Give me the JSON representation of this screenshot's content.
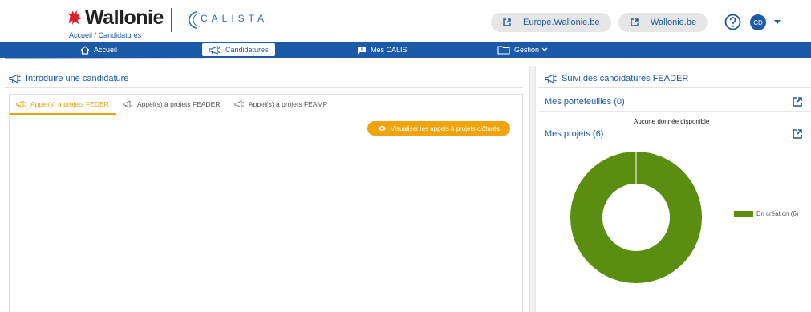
{
  "header": {
    "brand": "Wallonie",
    "app_name": "CALISTA",
    "breadcrumb": [
      "Accueil",
      "Candidatures"
    ],
    "breadcrumb_sep": "/",
    "links": [
      "Europe.Wallonie.be",
      "Wallonie.be"
    ],
    "user_initials": "CD",
    "icons": [
      "rooster-icon",
      "external-link-icon",
      "help-icon",
      "chevron-down-icon"
    ]
  },
  "nav": {
    "items": [
      {
        "label": "Accueil",
        "icon": "home-icon"
      },
      {
        "label": "Candidatures",
        "icon": "megaphone-icon",
        "active": true
      },
      {
        "label": "Mes CALIS",
        "icon": "chat-icon"
      },
      {
        "label": "Gestion",
        "icon": "folder-icon",
        "dropdown": true
      }
    ]
  },
  "left": {
    "title": "Introduire une candidature",
    "tabs": [
      {
        "label": "Appel(s) à projets FEDER",
        "active": true
      },
      {
        "label": "Appel(s) à projets FEADER"
      },
      {
        "label": "Appel(s) à projets FEAMP"
      }
    ],
    "closed_button": "Visualiser les appels à projets clôturés"
  },
  "right": {
    "title": "Suivi des candidatures FEADER",
    "portfolios": "Mes portefeuilles (0)",
    "no_data": "Aucune donnée disponible",
    "projects": "Mes projets (6)"
  },
  "colors": {
    "primary": "#1b5aa6",
    "accent": "#f0a30a",
    "brand_red": "#d8202a",
    "donut_green": "#5b8e10"
  },
  "chart_data": {
    "type": "pie",
    "categories": [
      "En création"
    ],
    "values": [
      6
    ],
    "legend": [
      "En création (6)"
    ],
    "legend_position": "right",
    "donut": true
  }
}
